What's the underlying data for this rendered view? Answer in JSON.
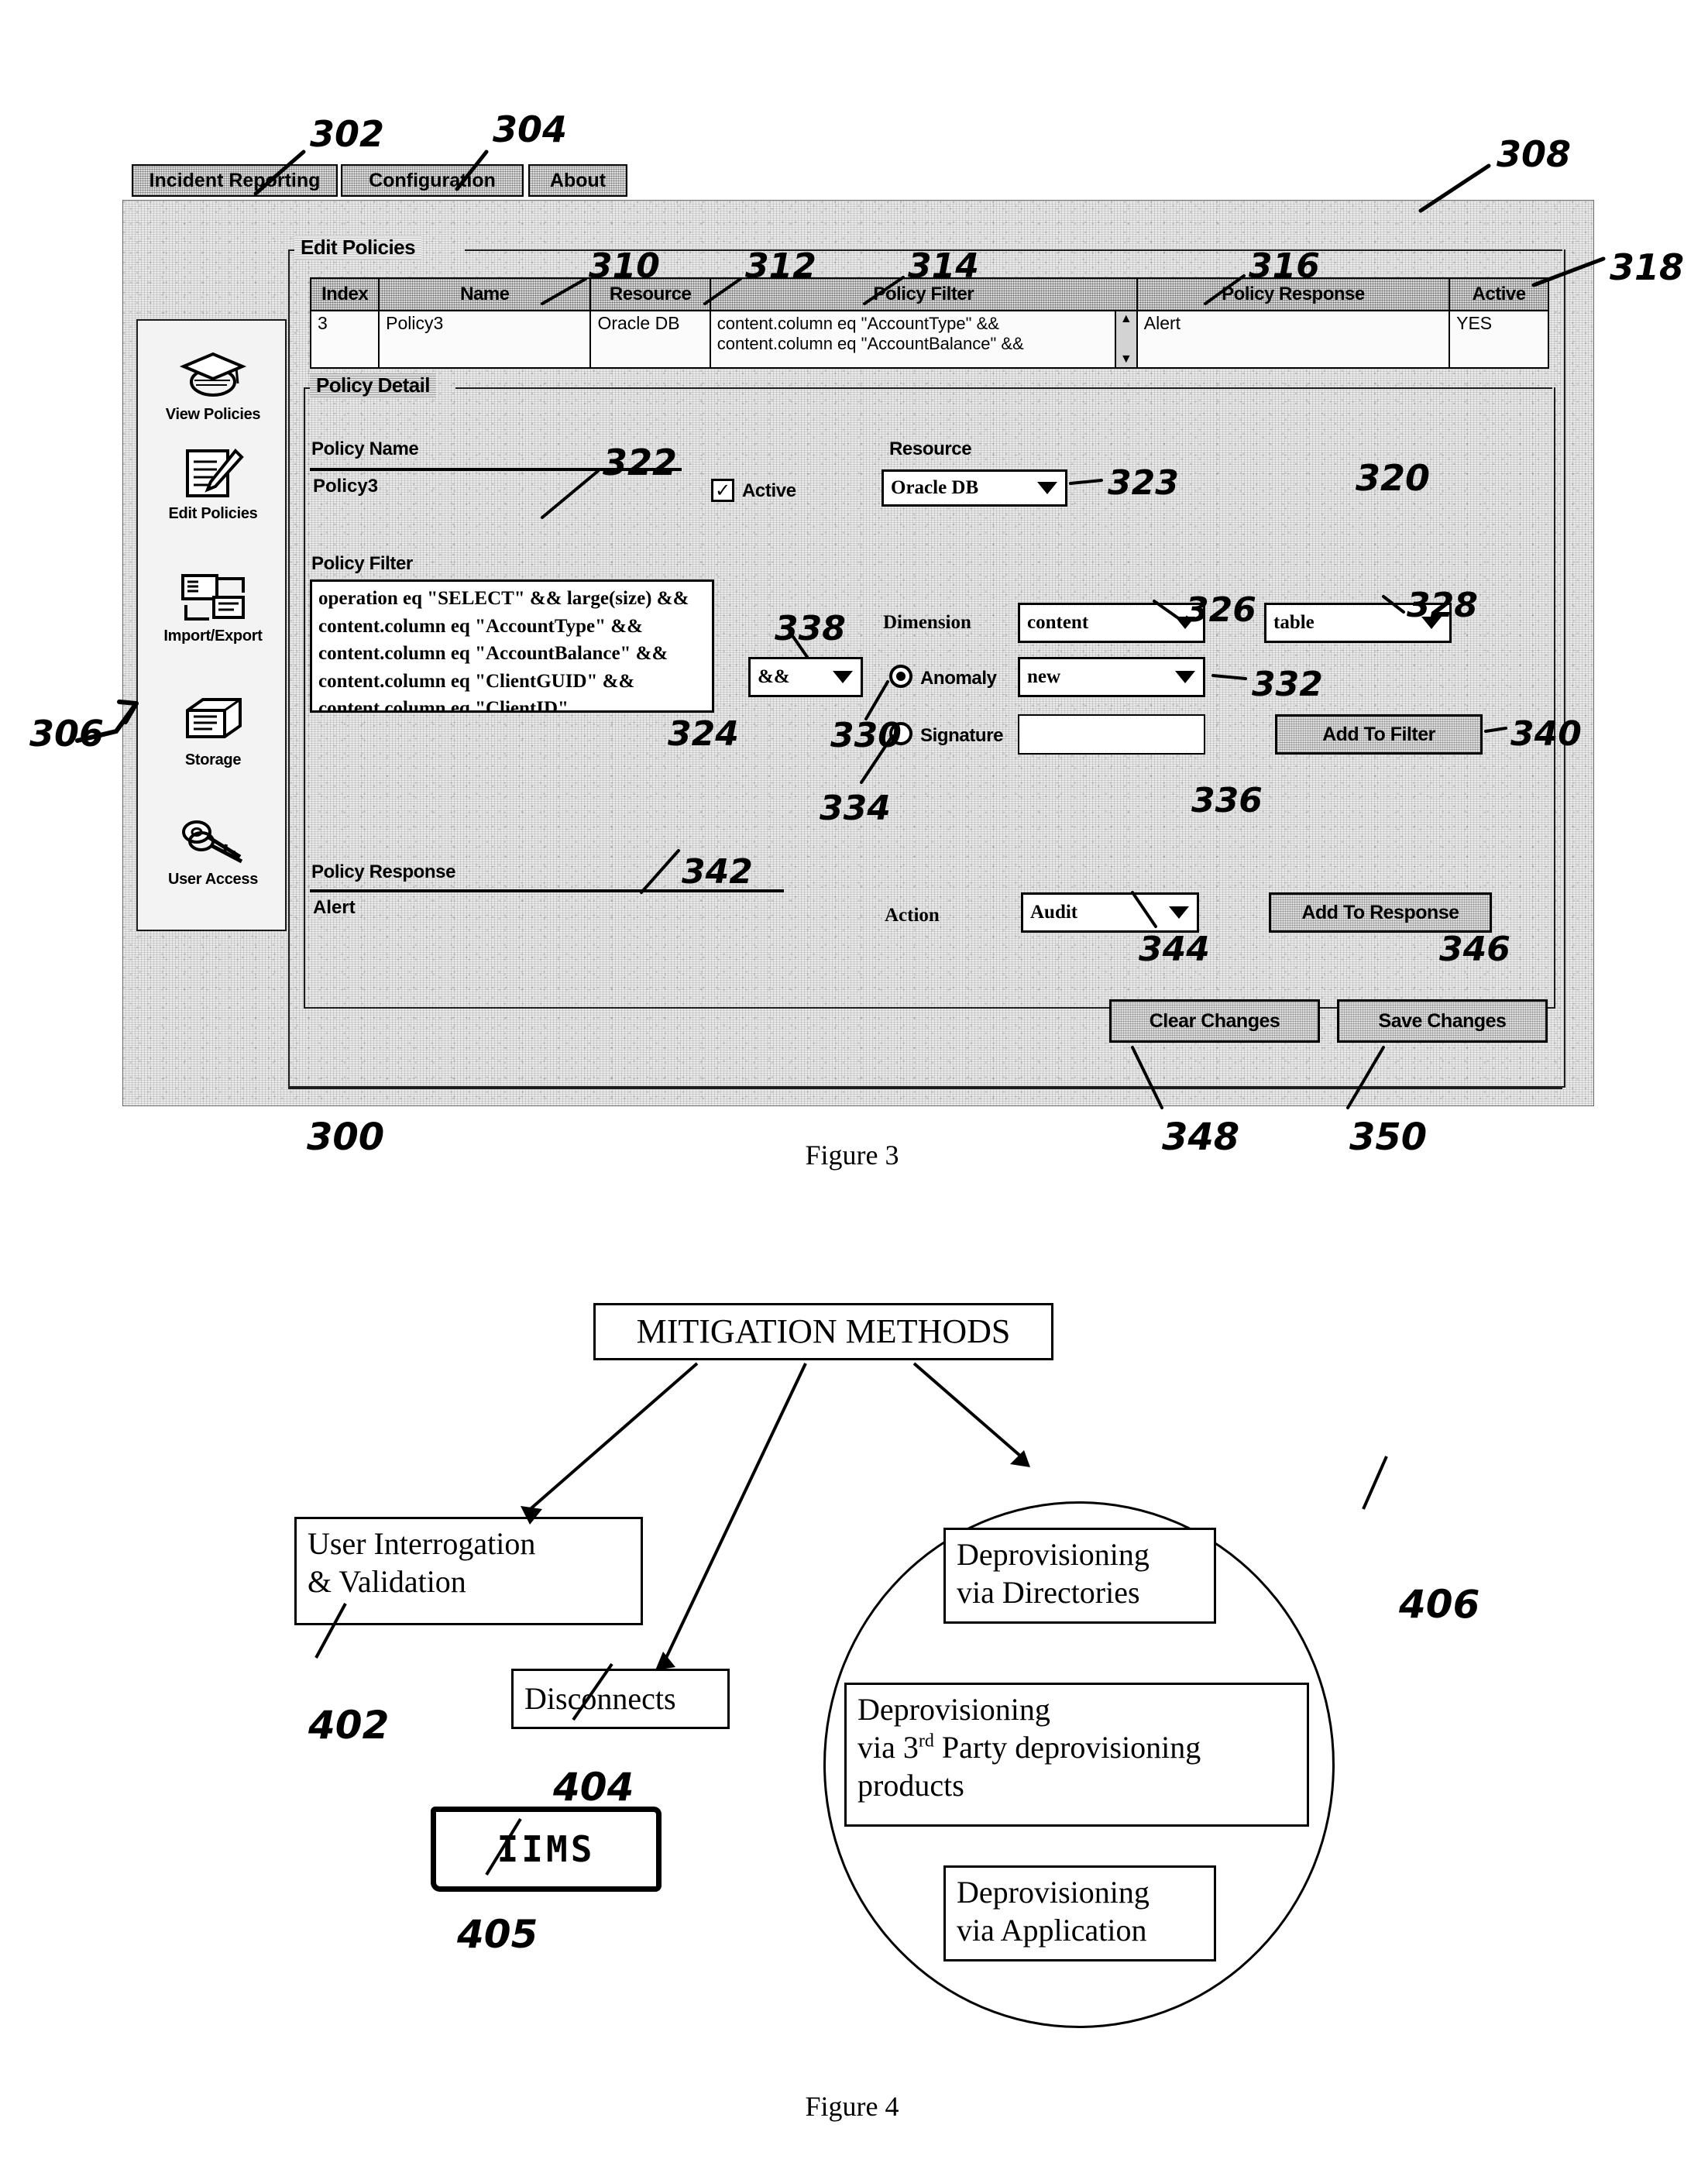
{
  "page": {
    "figure3_caption": "Figure 3",
    "figure4_caption": "Figure 4"
  },
  "figure3": {
    "ref_300": "300",
    "ref_302": "302",
    "ref_304": "304",
    "ref_306": "306",
    "ref_308": "308",
    "ref_310": "310",
    "ref_312": "312",
    "ref_314": "314",
    "ref_316": "316",
    "ref_318": "318",
    "ref_320": "320",
    "ref_322": "322",
    "ref_323": "323",
    "ref_324": "324",
    "ref_326": "326",
    "ref_328": "328",
    "ref_330": "330",
    "ref_332": "332",
    "ref_334": "334",
    "ref_336": "336",
    "ref_338": "338",
    "ref_340": "340",
    "ref_342": "342",
    "ref_344": "344",
    "ref_346": "346",
    "ref_348": "348",
    "ref_350": "350",
    "tabs": [
      {
        "label": "Incident Reporting",
        "selected": false
      },
      {
        "label": "Configuration",
        "selected": true
      },
      {
        "label": "About",
        "selected": false
      }
    ],
    "sidebar": {
      "items": [
        {
          "label": "View Policies",
          "icon": "graduation-cap-icon"
        },
        {
          "label": "Edit Policies",
          "icon": "notepad-pencil-icon"
        },
        {
          "label": "Import/Export",
          "icon": "import-export-icon"
        },
        {
          "label": "Storage",
          "icon": "file-drawer-icon"
        },
        {
          "label": "User Access",
          "icon": "keys-icon"
        }
      ]
    },
    "edit_policies": {
      "group_label": "Edit Policies",
      "table": {
        "headers": [
          "Index",
          "Name",
          "Resource",
          "Policy Filter",
          "Policy Response",
          "Active"
        ],
        "rows": [
          {
            "index": "3",
            "name": "Policy3",
            "resource": "Oracle DB",
            "filter": "content.column eq \"AccountType\" &&\ncontent.column eq \"AccountBalance\" &&",
            "response": "Alert",
            "active": "YES"
          }
        ]
      }
    },
    "policy_detail": {
      "group_label": "Policy Detail",
      "policy_name_label": "Policy Name",
      "policy_name_value": "Policy3",
      "active_label": "Active",
      "active_checked": true,
      "active_check_glyph": "✓",
      "resource_label": "Resource",
      "resource_value": "Oracle DB",
      "policy_filter_label": "Policy Filter",
      "policy_filter_value": "operation eq \"SELECT\" && large(size) &&\ncontent.column eq \"AccountType\" &&\ncontent.column eq \"AccountBalance\" &&\ncontent.column eq \"ClientGUID\" &&\ncontent.column eq \"ClientID\"",
      "dimension_label": "Dimension",
      "dimension_value": "content",
      "dimension_scope_value": "table",
      "operator_value": "&&",
      "anomaly_label": "Anomaly",
      "anomaly_selected": true,
      "anomaly_value": "new",
      "signature_label": "Signature",
      "signature_selected": false,
      "signature_value": "",
      "add_to_filter_label": "Add To Filter",
      "policy_response_label": "Policy Response",
      "policy_response_value": "Alert",
      "action_label": "Action",
      "action_value": "Audit",
      "add_to_response_label": "Add To Response"
    },
    "footer_buttons": {
      "clear_label": "Clear Changes",
      "save_label": "Save Changes"
    }
  },
  "figure4": {
    "title_box": "MITIGATION METHODS",
    "nodes": [
      {
        "id": "402",
        "label": "User Interrogation\n& Validation",
        "ref": "402"
      },
      {
        "id": "404",
        "label": "Disconnects",
        "ref": "404"
      },
      {
        "id": "405",
        "label": "IIMS",
        "ref": "405"
      },
      {
        "id": "406a",
        "label": "Deprovisioning\nvia Directories",
        "ref": ""
      },
      {
        "id": "406b",
        "label": "Deprovisioning\nvia 3rd Party deprovisioning\nproducts",
        "ref": ""
      },
      {
        "id": "406c",
        "label": "Deprovisioning\nvia Application",
        "ref": ""
      }
    ],
    "ref_402": "402",
    "ref_404": "404",
    "ref_405": "405",
    "ref_406": "406",
    "box_406b_line1": "Deprovisioning",
    "box_406b_line2_pre": "via 3",
    "box_406b_line2_sup": "rd",
    "box_406b_line2_post": " Party deprovisioning",
    "box_406b_line3": "products"
  }
}
